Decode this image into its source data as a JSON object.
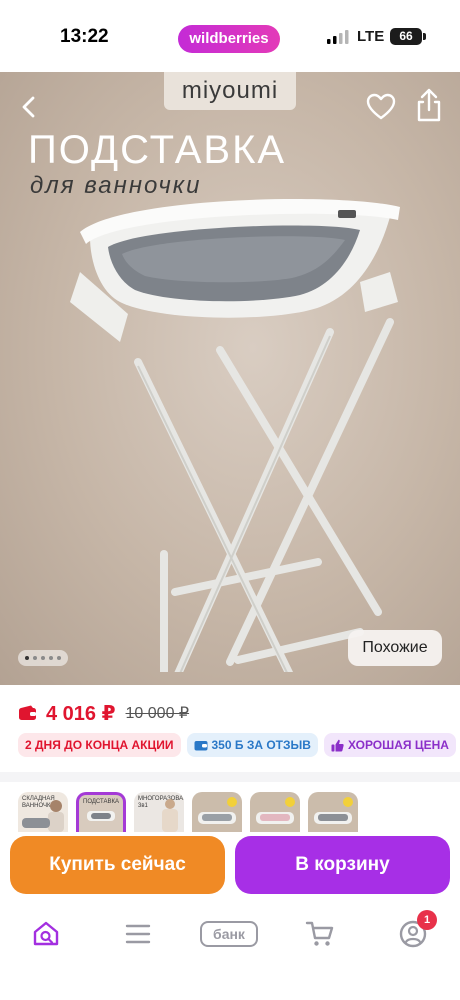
{
  "status_bar": {
    "time": "13:22",
    "app_badge": "wildberries",
    "network": "LTE",
    "battery": "66",
    "icons": [
      "signal-icon",
      "battery-icon"
    ]
  },
  "gallery": {
    "brand_logo": "miyoumi",
    "promo_title": "ПОДСТАВКА",
    "promo_subtitle": "для ванночки",
    "similar_button": "Похожие",
    "slide_count": 5,
    "active_slide": 1,
    "icons": [
      "back-icon",
      "heart-icon",
      "share-icon"
    ]
  },
  "price": {
    "current": "4 016 ₽",
    "old": "10 000 ₽",
    "icon": "wallet-icon",
    "color": "#e0152f"
  },
  "badges": [
    {
      "label": "2 ДНЯ ДО КОНЦА АКЦИИ",
      "color": "#e0152f"
    },
    {
      "label": "350 Б ЗА ОТЗЫВ",
      "icon": "wallet-icon",
      "color": "#2a78c7"
    },
    {
      "label": "ХОРОШАЯ ЦЕНА",
      "icon": "thumbs-up-icon",
      "color": "#8b2fc9"
    }
  ],
  "thumbnails": [
    {
      "label": "СКЛАДНАЯ ВАННОЧКА"
    },
    {
      "label": "ПОДСТАВКА",
      "active": true
    },
    {
      "label": "МНОГОРАЗОВАЯ 3в1"
    },
    {
      "label": ""
    },
    {
      "label": ""
    },
    {
      "label": ""
    }
  ],
  "actions": {
    "buy_now": "Купить сейчас",
    "add_to_cart": "В корзину",
    "buy_color": "#f08a25",
    "cart_color": "#a72fe6"
  },
  "tab_bar": {
    "bank_label": "банк",
    "profile_badge": "1",
    "icons": [
      "home-search-icon",
      "catalog-icon",
      "bank-icon",
      "cart-icon",
      "profile-icon"
    ]
  }
}
